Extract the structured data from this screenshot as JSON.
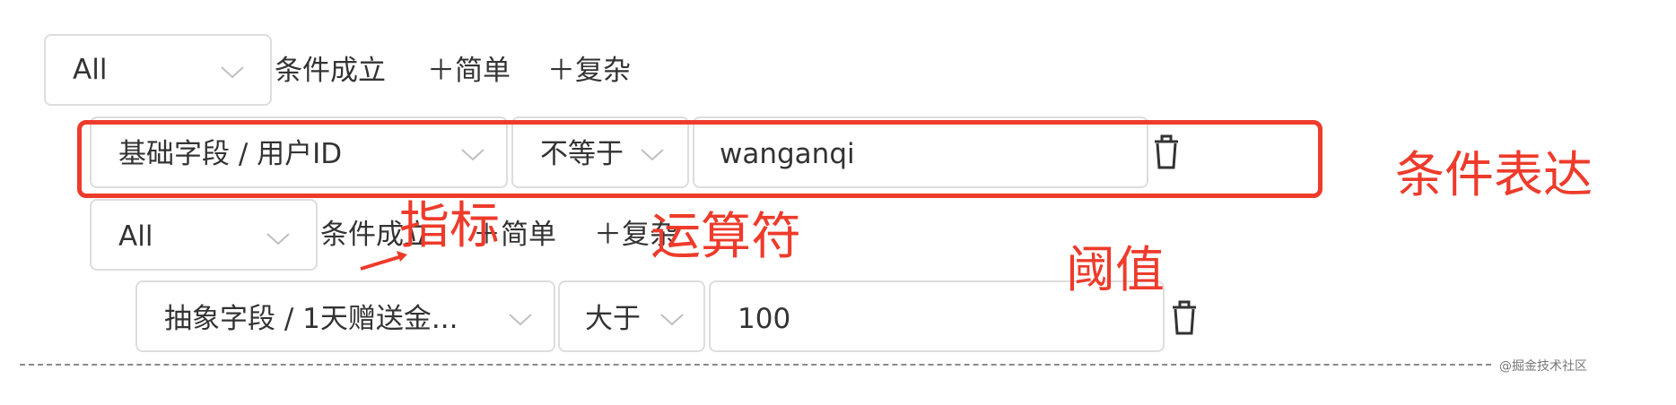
{
  "group1": {
    "select_value": "All",
    "condition_text": "条件成立",
    "add_simple": "＋简单",
    "add_complex": "＋复杂"
  },
  "row1": {
    "field_value": "基础字段 / 用户ID",
    "operator_value": "不等于",
    "threshold_value": "wanganqi"
  },
  "group2": {
    "select_value": "All",
    "condition_text": "条件成立",
    "add_simple": "＋简单",
    "add_complex": "＋复杂"
  },
  "row2": {
    "field_value": "抽象字段 / 1天赠送金...",
    "operator_value": "大于",
    "threshold_value": "100"
  },
  "annotations": {
    "condition_expression": "条件表达",
    "metric": "指标",
    "operator": "运算符",
    "threshold": "阈值",
    "color": "#ee3b2b"
  },
  "watermark": "@掘金技术社区",
  "icons": [
    "chevron-down-icon",
    "trash-icon"
  ]
}
